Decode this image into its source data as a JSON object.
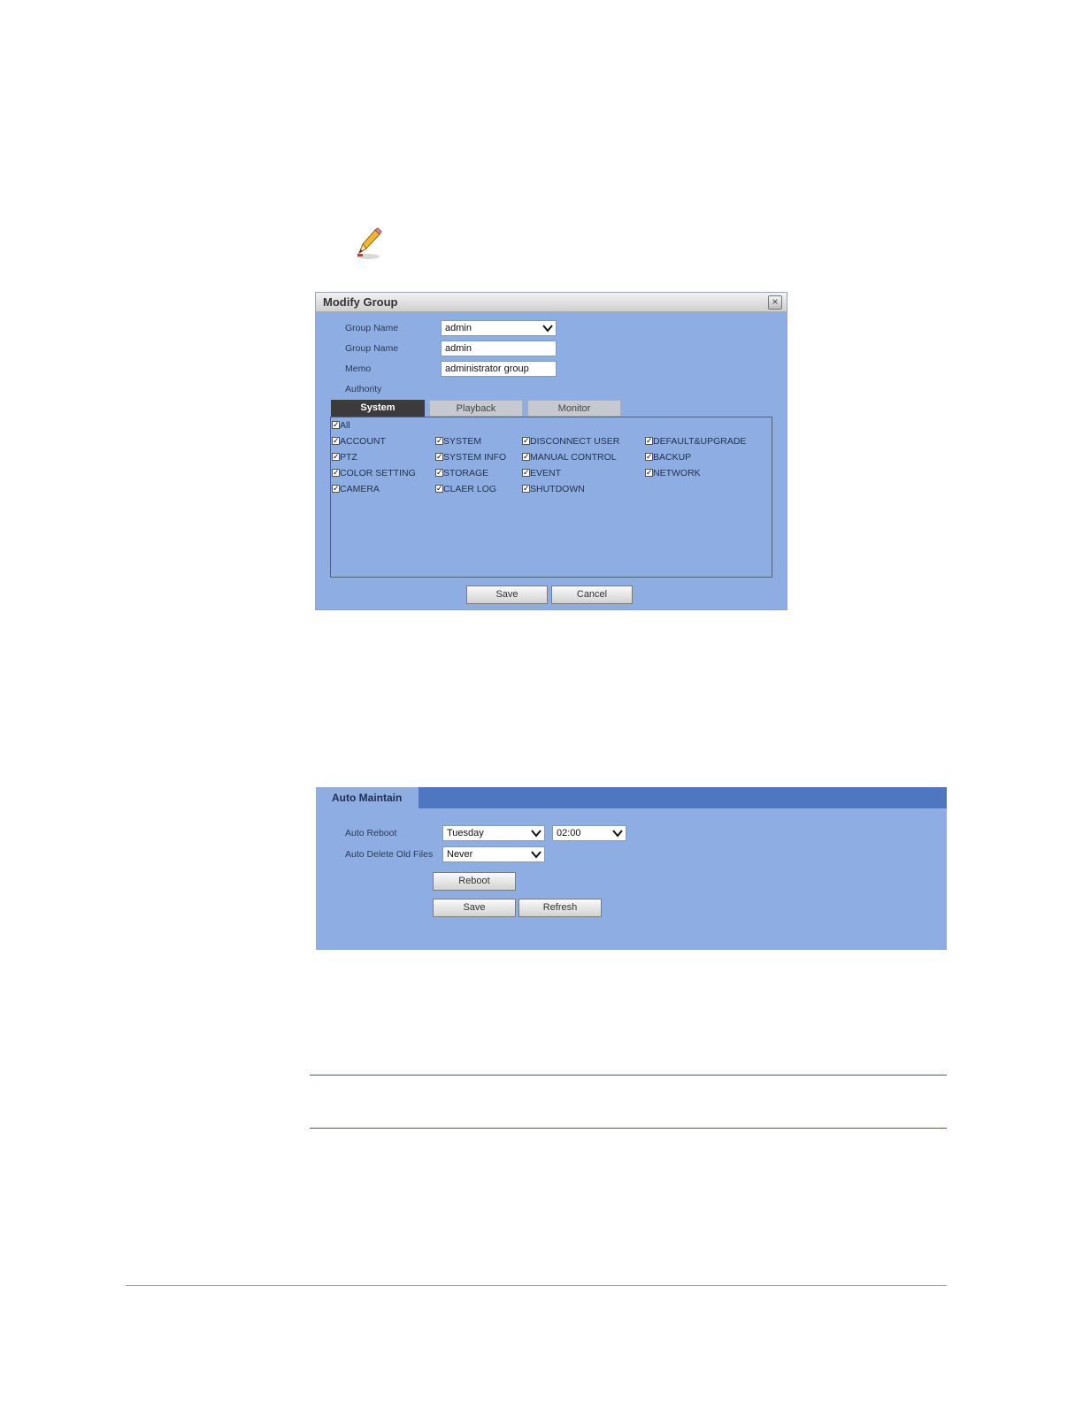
{
  "dialog": {
    "title": "Modify Group",
    "close_glyph": "×",
    "group_name_select_label": "Group Name",
    "group_name_select_value": "admin",
    "group_name_input_label": "Group Name",
    "group_name_input_value": "admin",
    "memo_label": "Memo",
    "memo_value": "administrator group",
    "authority_label": "Authority",
    "tabs": [
      "System",
      "Playback",
      "Monitor"
    ],
    "active_tab": "System",
    "permissions": {
      "all": "All",
      "col1": [
        "ACCOUNT",
        "PTZ",
        "COLOR SETTING",
        "CAMERA"
      ],
      "col2": [
        "SYSTEM",
        "SYSTEM INFO",
        "STORAGE",
        "CLAER LOG"
      ],
      "col3": [
        "DISCONNECT USER",
        "MANUAL CONTROL",
        "EVENT",
        "SHUTDOWN"
      ],
      "col4": [
        "DEFAULT&UPGRADE",
        "BACKUP",
        "NETWORK"
      ]
    },
    "save_label": "Save",
    "cancel_label": "Cancel"
  },
  "auto_maintain": {
    "title": "Auto Maintain",
    "auto_reboot_label": "Auto Reboot",
    "auto_reboot_day": "Tuesday",
    "auto_reboot_time": "02:00",
    "auto_delete_label": "Auto Delete Old Files",
    "auto_delete_value": "Never",
    "reboot_label": "Reboot",
    "save_label": "Save",
    "refresh_label": "Refresh"
  },
  "colors": {
    "panel_bg": "#8eaee3",
    "panel_header": "#4f77bf",
    "rule_blue": "#3a55b0",
    "rule_gray": "#9a9a9a"
  },
  "icons": [
    "pencil-note-icon",
    "close-icon",
    "chevron-down-icon",
    "checkbox-checked-icon"
  ]
}
